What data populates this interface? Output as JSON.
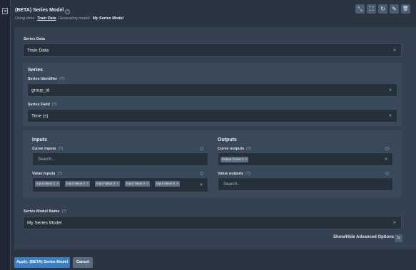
{
  "header": {
    "title": "(BETA) Series Model",
    "using_data_label": "Using data:",
    "using_data_link": "Train Data",
    "generating_label": "Generating model:",
    "generating_model": "My Series Model"
  },
  "toolbar": {
    "collapse_icon": "⤡",
    "expand_icon": "⛶",
    "refresh_icon": "↻",
    "edit_icon": "✎",
    "delete_icon": "🗑"
  },
  "series_data": {
    "label": "Series Data",
    "value": "Train Data"
  },
  "series": {
    "heading": "Series",
    "identifier": {
      "label": "Series Identifier",
      "help": "(?)",
      "value": "group_id"
    },
    "field": {
      "label": "Series Field",
      "help": "(?)",
      "value": "Time (s)"
    }
  },
  "inputs": {
    "heading": "Inputs",
    "curve": {
      "label": "Curve inputs",
      "help": "(?)",
      "placeholder": "Search..."
    },
    "value": {
      "label": "Value inputs",
      "help": "(?)",
      "tags": [
        "Input Value 1",
        "Input Value 2",
        "Input Value 3",
        "Input Value 4",
        "Input Value 5"
      ]
    }
  },
  "outputs": {
    "heading": "Outputs",
    "curve": {
      "label": "Curve outputs",
      "help": "(?)",
      "tags": [
        "Output Curve 1"
      ]
    },
    "value": {
      "label": "Value outputs",
      "help": "(?)",
      "placeholder": "Search..."
    }
  },
  "model_name": {
    "label": "Series Model Name",
    "help": "(?)",
    "value": "My Series Model"
  },
  "advanced": {
    "label": "Show/Hide Advanced Options",
    "icon": "⇆"
  },
  "footer": {
    "apply_label": "Apply: (BETA) Series Model",
    "cancel_label": "Cancel"
  },
  "common": {
    "clear": "×"
  }
}
